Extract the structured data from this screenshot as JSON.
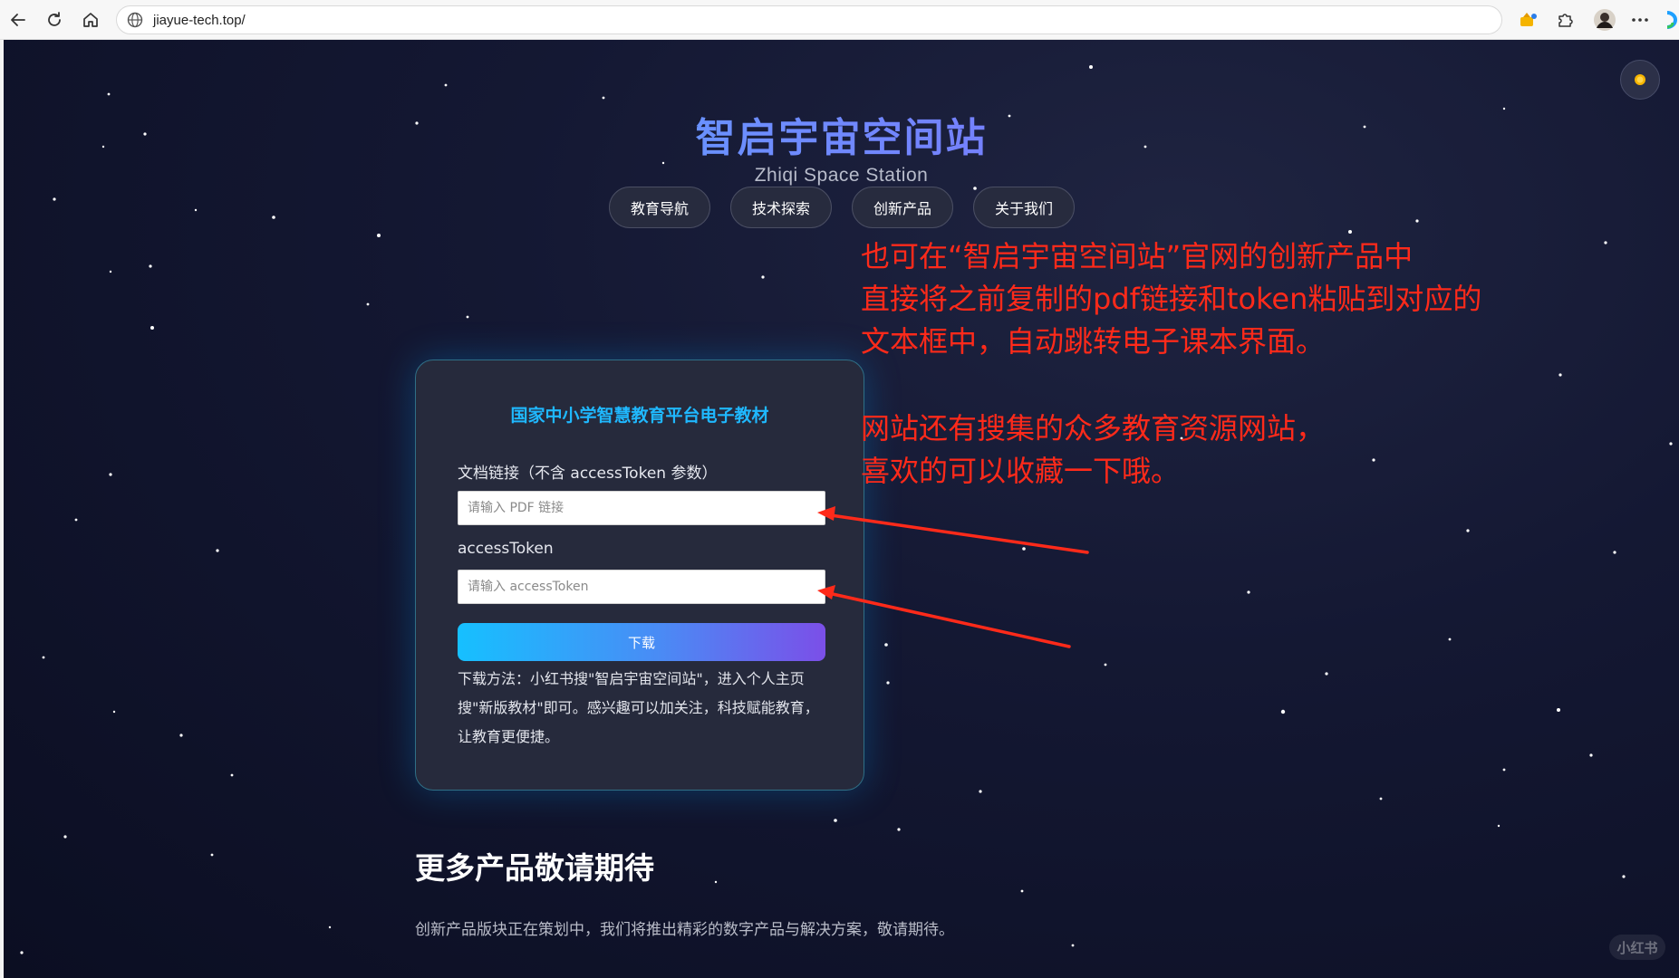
{
  "browser": {
    "url": "jiayue-tech.top/"
  },
  "site": {
    "title": "智启宇宙空间站",
    "subtitle": "Zhiqi Space Station",
    "nav": [
      {
        "label": "教育导航"
      },
      {
        "label": "技术探索"
      },
      {
        "label": "创新产品"
      },
      {
        "label": "关于我们"
      }
    ]
  },
  "annotation": {
    "lines_1": [
      "也可在“智启宇宙空间站”官网的创新产品中",
      "直接将之前复制的pdf链接和token粘贴到对应的",
      "文本框中，自动跳转电子课本界面。"
    ],
    "lines_2": [
      "网站还有搜集的众多教育资源网站，",
      "喜欢的可以收藏一下哦。"
    ],
    "color": "#ff2a1a"
  },
  "card": {
    "title": "国家中小学智慧教育平台电子教材",
    "doc_link_label": "文档链接（不含 accessToken 参数）",
    "doc_link_placeholder": "请输入 PDF 链接",
    "doc_link_value": "",
    "token_label": "accessToken",
    "token_placeholder": "请输入 accessToken",
    "token_value": "",
    "download_label": "下载",
    "note": "下载方法：小红书搜\"智启宇宙空间站\"，进入个人主页搜\"新版教材\"即可。感兴趣可以加关注，科技赋能教育，让教育更便捷。"
  },
  "more": {
    "title": "更多产品敬请期待",
    "description": "创新产品版块正在策划中，我们将推出精彩的数字产品与解决方案，敬请期待。"
  },
  "watermark": "小红书",
  "colors": {
    "accent_cyan": "#1fb8ff",
    "accent_purple": "#7b4fe8",
    "page_bg": "#141833"
  }
}
